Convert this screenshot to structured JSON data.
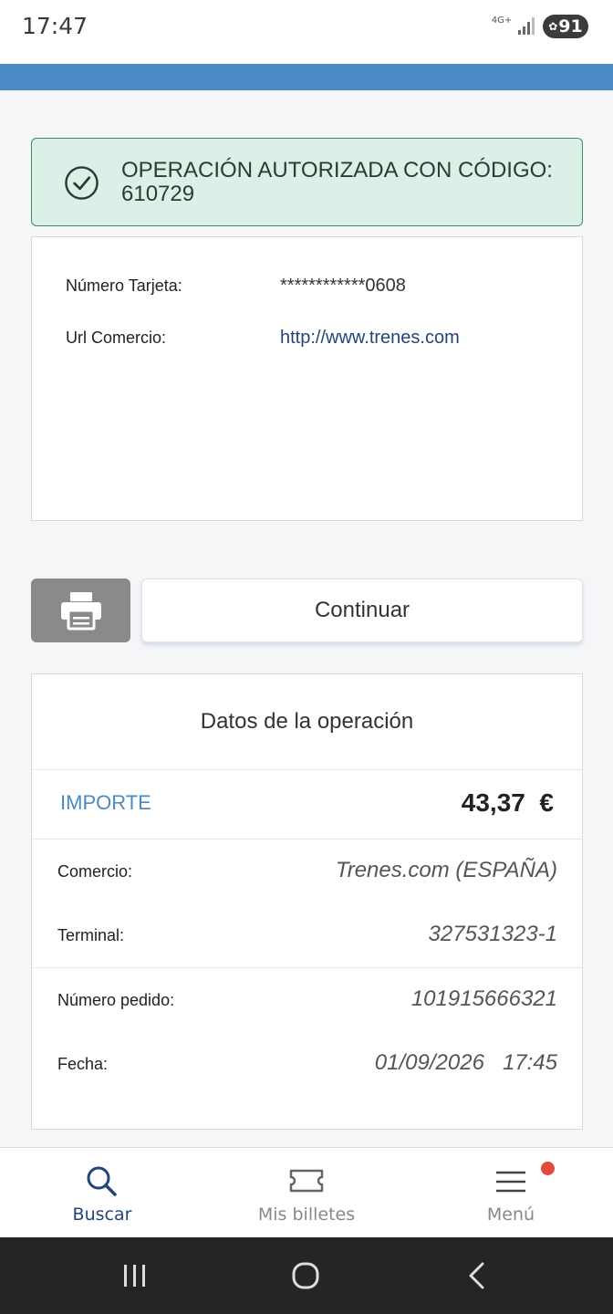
{
  "status_bar": {
    "time": "17:47",
    "network": "4G+",
    "battery": "91"
  },
  "success": {
    "message": "OPERACIÓN AUTORIZADA CON CÓDIGO: 610729"
  },
  "card_info": {
    "card_number_label": "Número Tarjeta:",
    "card_number_value": "************0608",
    "url_label": "Url Comercio:",
    "url_value": "http://www.trenes.com"
  },
  "actions": {
    "continue_label": "Continuar"
  },
  "operation": {
    "title": "Datos de la operación",
    "amount_label": "IMPORTE",
    "amount_value": "43,37",
    "currency": "€",
    "merchant_label": "Comercio:",
    "merchant_value": "Trenes.com (ESPAÑA)",
    "terminal_label": "Terminal:",
    "terminal_value": "327531323-1",
    "order_label": "Número pedido:",
    "order_value": "101915666321",
    "date_label": "Fecha:",
    "date_value": "01/09/2026",
    "time_value": "17:45"
  },
  "bottom_nav": {
    "items": [
      {
        "label": "Buscar",
        "icon": "search-icon",
        "active": true
      },
      {
        "label": "Mis billetes",
        "icon": "ticket-icon",
        "active": false
      },
      {
        "label": "Menú",
        "icon": "menu-icon",
        "active": false
      }
    ]
  },
  "colors": {
    "accent_blue": "#4a8bc5",
    "nav_active": "#23457a",
    "success_bg": "#dbf1e8",
    "success_border": "#3e8b63",
    "badge_red": "#e24b3b"
  }
}
